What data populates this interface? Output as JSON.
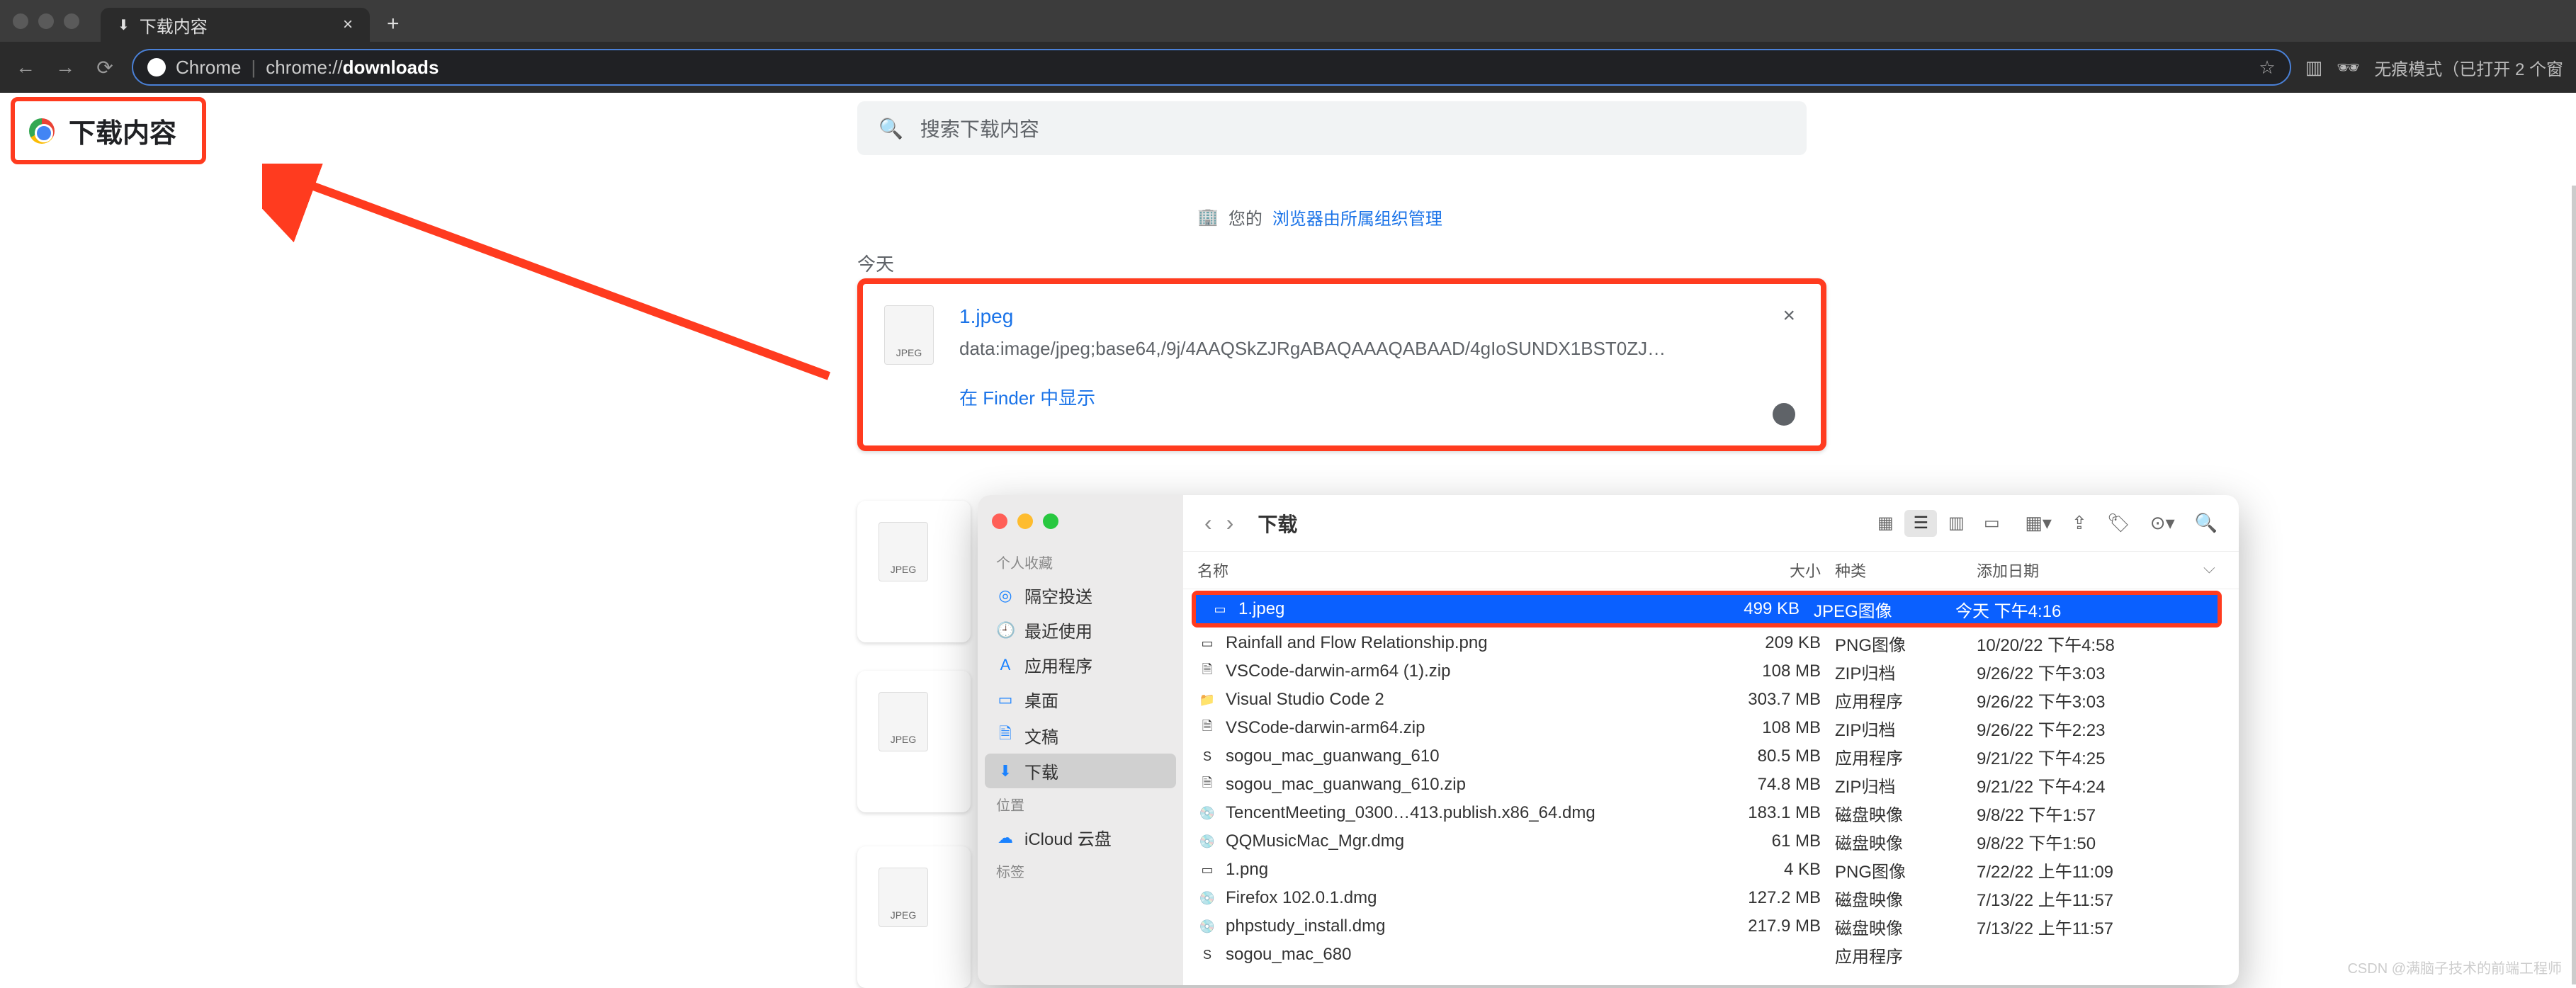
{
  "browser": {
    "tab_title": "下载内容",
    "addr_prefix": "Chrome",
    "addr_path_prefix": "chrome://",
    "addr_path_bold": "downloads",
    "incognito": "无痕模式（已打开 2 个窗"
  },
  "page": {
    "title": "下载内容",
    "search_placeholder": "搜索下载内容",
    "org_notice_prefix": "您的",
    "org_notice_link": "浏览器由所属组织管理",
    "today": "今天"
  },
  "download": {
    "filename": "1.jpeg",
    "url": "data:image/jpeg;base64,/9j/4AAQSkZJRgABAQAAAQABAAD/4gIoSUNDX1BST0ZJT…",
    "action": "在 Finder 中显示"
  },
  "finder": {
    "title": "下载",
    "sidebar": {
      "favorites_label": "个人收藏",
      "items": [
        {
          "icon": "◎",
          "label": "隔空投送"
        },
        {
          "icon": "🕘",
          "label": "最近使用"
        },
        {
          "icon": "A",
          "label": "应用程序"
        },
        {
          "icon": "▭",
          "label": "桌面"
        },
        {
          "icon": "🗎",
          "label": "文稿"
        },
        {
          "icon": "⬇",
          "label": "下载"
        }
      ],
      "locations_label": "位置",
      "locations": [
        {
          "icon": "☁",
          "label": "iCloud 云盘"
        }
      ],
      "tags_label": "标签"
    },
    "columns": {
      "name": "名称",
      "size": "大小",
      "kind": "种类",
      "date": "添加日期"
    },
    "rows": [
      {
        "icon": "▭",
        "name": "1.jpeg",
        "size": "499 KB",
        "kind": "JPEG图像",
        "date": "今天 下午4:16",
        "selected": true
      },
      {
        "icon": "▭",
        "name": "Rainfall and Flow Relationship.png",
        "size": "209 KB",
        "kind": "PNG图像",
        "date": "10/20/22 下午4:58"
      },
      {
        "icon": "🗎",
        "name": "VSCode-darwin-arm64 (1).zip",
        "size": "108 MB",
        "kind": "ZIP归档",
        "date": "9/26/22 下午3:03"
      },
      {
        "icon": "📁",
        "name": "Visual Studio Code 2",
        "size": "303.7 MB",
        "kind": "应用程序",
        "date": "9/26/22 下午3:03"
      },
      {
        "icon": "🗎",
        "name": "VSCode-darwin-arm64.zip",
        "size": "108 MB",
        "kind": "ZIP归档",
        "date": "9/26/22 下午2:23"
      },
      {
        "icon": "S",
        "name": "sogou_mac_guanwang_610",
        "size": "80.5 MB",
        "kind": "应用程序",
        "date": "9/21/22 下午4:25"
      },
      {
        "icon": "🗎",
        "name": "sogou_mac_guanwang_610.zip",
        "size": "74.8 MB",
        "kind": "ZIP归档",
        "date": "9/21/22 下午4:24"
      },
      {
        "icon": "💿",
        "name": "TencentMeeting_0300…413.publish.x86_64.dmg",
        "size": "183.1 MB",
        "kind": "磁盘映像",
        "date": "9/8/22 下午1:57"
      },
      {
        "icon": "💿",
        "name": "QQMusicMac_Mgr.dmg",
        "size": "61 MB",
        "kind": "磁盘映像",
        "date": "9/8/22 下午1:50"
      },
      {
        "icon": "▭",
        "name": "1.png",
        "size": "4 KB",
        "kind": "PNG图像",
        "date": "7/22/22 上午11:09"
      },
      {
        "icon": "💿",
        "name": "Firefox 102.0.1.dmg",
        "size": "127.2 MB",
        "kind": "磁盘映像",
        "date": "7/13/22 上午11:57"
      },
      {
        "icon": "💿",
        "name": "phpstudy_install.dmg",
        "size": "217.9 MB",
        "kind": "磁盘映像",
        "date": "7/13/22 上午11:57"
      },
      {
        "icon": "S",
        "name": "sogou_mac_680",
        "size": "",
        "kind": "应用程序",
        "date": ""
      }
    ]
  },
  "watermark": "CSDN @满脑子技术的前端工程师"
}
